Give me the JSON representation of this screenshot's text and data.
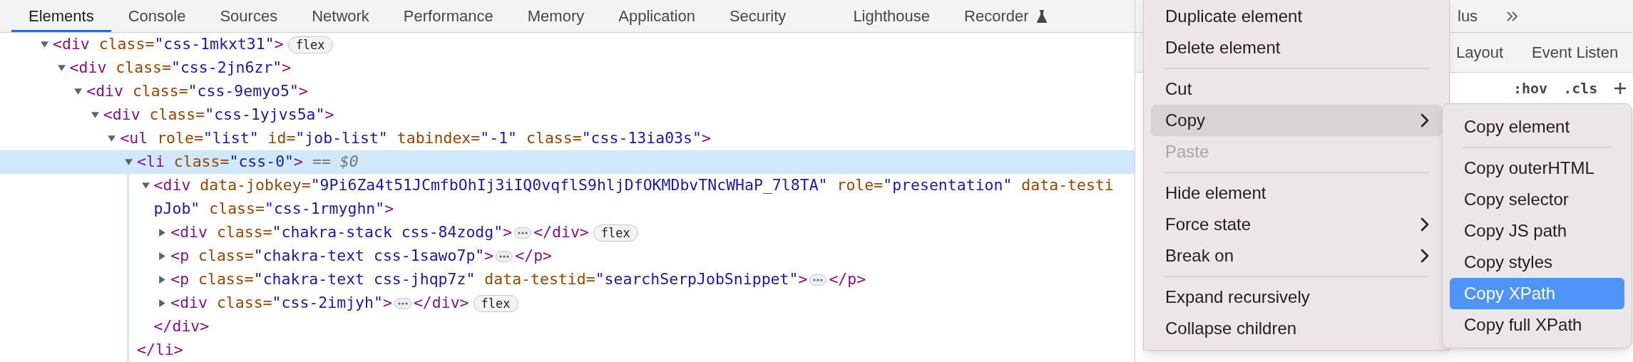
{
  "tabs": [
    {
      "label": "Elements",
      "selected": true,
      "experimental": false
    },
    {
      "label": "Console",
      "selected": false,
      "experimental": false
    },
    {
      "label": "Sources",
      "selected": false,
      "experimental": false
    },
    {
      "label": "Network",
      "selected": false,
      "experimental": false
    },
    {
      "label": "Performance",
      "selected": false,
      "experimental": false
    },
    {
      "label": "Memory",
      "selected": false,
      "experimental": false
    },
    {
      "label": "Application",
      "selected": false,
      "experimental": false
    },
    {
      "label": "Security",
      "selected": false,
      "experimental": false
    },
    {
      "label": "Lighthouse",
      "selected": false,
      "experimental": false
    },
    {
      "label": "Recorder",
      "selected": false,
      "experimental": true
    }
  ],
  "dom_tree": [
    {
      "expanded": true,
      "selected": false,
      "segments": [
        {
          "kind": "code",
          "tokens": [
            {
              "kind": "tag",
              "text": "<div"
            },
            {
              "kind": "attr",
              "text": " class="
            },
            {
              "kind": "value",
              "text": "\"css-1mkxt31\""
            },
            {
              "kind": "tag",
              "text": ">"
            }
          ]
        },
        {
          "kind": "badge",
          "text": "flex"
        }
      ],
      "children": [
        {
          "expanded": true,
          "selected": false,
          "segments": [
            {
              "kind": "code",
              "tokens": [
                {
                  "kind": "tag",
                  "text": "<div"
                },
                {
                  "kind": "attr",
                  "text": " class="
                },
                {
                  "kind": "value",
                  "text": "\"css-2jn6zr\""
                },
                {
                  "kind": "tag",
                  "text": ">"
                }
              ]
            }
          ],
          "children": [
            {
              "expanded": true,
              "selected": false,
              "segments": [
                {
                  "kind": "code",
                  "tokens": [
                    {
                      "kind": "tag",
                      "text": "<div"
                    },
                    {
                      "kind": "attr",
                      "text": " class="
                    },
                    {
                      "kind": "value",
                      "text": "\"css-9emyo5\""
                    },
                    {
                      "kind": "tag",
                      "text": ">"
                    }
                  ]
                }
              ],
              "children": [
                {
                  "expanded": true,
                  "selected": false,
                  "segments": [
                    {
                      "kind": "code",
                      "tokens": [
                        {
                          "kind": "tag",
                          "text": "<div"
                        },
                        {
                          "kind": "attr",
                          "text": " class="
                        },
                        {
                          "kind": "value",
                          "text": "\"css-1yjvs5a\""
                        },
                        {
                          "kind": "tag",
                          "text": ">"
                        }
                      ]
                    }
                  ],
                  "children": [
                    {
                      "expanded": true,
                      "selected": false,
                      "segments": [
                        {
                          "kind": "code",
                          "tokens": [
                            {
                              "kind": "tag",
                              "text": "<ul"
                            },
                            {
                              "kind": "attr",
                              "text": " role="
                            },
                            {
                              "kind": "value",
                              "text": "\"list\""
                            },
                            {
                              "kind": "attr",
                              "text": " id="
                            },
                            {
                              "kind": "value",
                              "text": "\"job-list\""
                            },
                            {
                              "kind": "attr",
                              "text": " tabindex="
                            },
                            {
                              "kind": "value",
                              "text": "\"-1\""
                            },
                            {
                              "kind": "attr",
                              "text": " class="
                            },
                            {
                              "kind": "value",
                              "text": "\"css-13ia03s\""
                            },
                            {
                              "kind": "tag",
                              "text": ">"
                            }
                          ]
                        }
                      ],
                      "children": [
                        {
                          "expanded": true,
                          "selected": true,
                          "segments": [
                            {
                              "kind": "code",
                              "tokens": [
                                {
                                  "kind": "tag",
                                  "text": "<li"
                                },
                                {
                                  "kind": "attr",
                                  "text": " class="
                                },
                                {
                                  "kind": "value",
                                  "text": "\"css-0\""
                                },
                                {
                                  "kind": "tag",
                                  "text": ">"
                                },
                                {
                                  "kind": "note",
                                  "text": " == $0"
                                }
                              ]
                            }
                          ],
                          "closing": "</li>",
                          "children": [
                            {
                              "expanded": true,
                              "selected": false,
                              "segments": [
                                {
                                  "kind": "code",
                                  "tokens": [
                                    {
                                      "kind": "tag",
                                      "text": "<div"
                                    },
                                    {
                                      "kind": "attr",
                                      "text": " data-jobkey="
                                    },
                                    {
                                      "kind": "value",
                                      "text": "\"9Pi6Za4t51JCmfbOhIj3iIQ0vqflS9hljDfOKMDbvTNcWHaP_7l8TA\""
                                    },
                                    {
                                      "kind": "attr",
                                      "text": " role="
                                    },
                                    {
                                      "kind": "value",
                                      "text": "\"presentation\""
                                    },
                                    {
                                      "kind": "attr",
                                      "text": " data-testi"
                                    }
                                  ]
                                }
                              ],
                              "continuation": [
                                {
                                  "kind": "value",
                                  "text": "pJob\""
                                },
                                {
                                  "kind": "attr",
                                  "text": " class="
                                },
                                {
                                  "kind": "value",
                                  "text": "\"css-1rmyghn\""
                                },
                                {
                                  "kind": "tag",
                                  "text": ">"
                                }
                              ],
                              "closing": "</div>",
                              "children": [
                                {
                                  "expanded": false,
                                  "selected": false,
                                  "segments": [
                                    {
                                      "kind": "code",
                                      "tokens": [
                                        {
                                          "kind": "tag",
                                          "text": "<div"
                                        },
                                        {
                                          "kind": "attr",
                                          "text": " class="
                                        },
                                        {
                                          "kind": "value",
                                          "text": "\"chakra-stack css-84zodg\""
                                        },
                                        {
                                          "kind": "tag",
                                          "text": ">"
                                        }
                                      ]
                                    },
                                    {
                                      "kind": "ellipsis"
                                    },
                                    {
                                      "kind": "code",
                                      "tokens": [
                                        {
                                          "kind": "tag",
                                          "text": "</div>"
                                        }
                                      ]
                                    },
                                    {
                                      "kind": "badge",
                                      "text": "flex"
                                    }
                                  ]
                                },
                                {
                                  "expanded": false,
                                  "selected": false,
                                  "segments": [
                                    {
                                      "kind": "code",
                                      "tokens": [
                                        {
                                          "kind": "tag",
                                          "text": "<p"
                                        },
                                        {
                                          "kind": "attr",
                                          "text": " class="
                                        },
                                        {
                                          "kind": "value",
                                          "text": "\"chakra-text css-1sawo7p\""
                                        },
                                        {
                                          "kind": "tag",
                                          "text": ">"
                                        }
                                      ]
                                    },
                                    {
                                      "kind": "ellipsis"
                                    },
                                    {
                                      "kind": "code",
                                      "tokens": [
                                        {
                                          "kind": "tag",
                                          "text": "</p>"
                                        }
                                      ]
                                    }
                                  ]
                                },
                                {
                                  "expanded": false,
                                  "selected": false,
                                  "segments": [
                                    {
                                      "kind": "code",
                                      "tokens": [
                                        {
                                          "kind": "tag",
                                          "text": "<p"
                                        },
                                        {
                                          "kind": "attr",
                                          "text": " class="
                                        },
                                        {
                                          "kind": "value",
                                          "text": "\"chakra-text css-jhqp7z\""
                                        },
                                        {
                                          "kind": "attr",
                                          "text": " data-testid="
                                        },
                                        {
                                          "kind": "value",
                                          "text": "\"searchSerpJobSnippet\""
                                        },
                                        {
                                          "kind": "tag",
                                          "text": ">"
                                        }
                                      ]
                                    },
                                    {
                                      "kind": "ellipsis"
                                    },
                                    {
                                      "kind": "code",
                                      "tokens": [
                                        {
                                          "kind": "tag",
                                          "text": "</p>"
                                        }
                                      ]
                                    }
                                  ]
                                },
                                {
                                  "expanded": false,
                                  "selected": false,
                                  "segments": [
                                    {
                                      "kind": "code",
                                      "tokens": [
                                        {
                                          "kind": "tag",
                                          "text": "<div"
                                        },
                                        {
                                          "kind": "attr",
                                          "text": " class="
                                        },
                                        {
                                          "kind": "value",
                                          "text": "\"css-2imjyh\""
                                        },
                                        {
                                          "kind": "tag",
                                          "text": ">"
                                        }
                                      ]
                                    },
                                    {
                                      "kind": "ellipsis"
                                    },
                                    {
                                      "kind": "code",
                                      "tokens": [
                                        {
                                          "kind": "tag",
                                          "text": "</div>"
                                        }
                                      ]
                                    },
                                    {
                                      "kind": "badge",
                                      "text": "flex"
                                    }
                                  ]
                                }
                              ]
                            }
                          ]
                        }
                      ]
                    }
                  ]
                }
              ]
            }
          ]
        }
      ]
    }
  ],
  "side_panel": {
    "overflow_tab": "lus",
    "tabs": [
      {
        "label": "Layout",
        "selected": false
      },
      {
        "label": "Event Listen",
        "selected": false
      }
    ],
    "filters": [
      ":hov",
      ".cls"
    ]
  },
  "context_menu": [
    {
      "kind": "item",
      "label": "Duplicate element",
      "disabled": false,
      "submenu": false,
      "selected": false
    },
    {
      "kind": "item",
      "label": "Delete element",
      "disabled": false,
      "submenu": false,
      "selected": false
    },
    {
      "kind": "separator"
    },
    {
      "kind": "item",
      "label": "Cut",
      "disabled": false,
      "submenu": false,
      "selected": false
    },
    {
      "kind": "item",
      "label": "Copy",
      "disabled": false,
      "submenu": true,
      "selected": true
    },
    {
      "kind": "item",
      "label": "Paste",
      "disabled": true,
      "submenu": false,
      "selected": false
    },
    {
      "kind": "separator"
    },
    {
      "kind": "item",
      "label": "Hide element",
      "disabled": false,
      "submenu": false,
      "selected": false
    },
    {
      "kind": "item",
      "label": "Force state",
      "disabled": false,
      "submenu": true,
      "selected": false
    },
    {
      "kind": "item",
      "label": "Break on",
      "disabled": false,
      "submenu": true,
      "selected": false
    },
    {
      "kind": "separator"
    },
    {
      "kind": "item",
      "label": "Expand recursively",
      "disabled": false,
      "submenu": false,
      "selected": false
    },
    {
      "kind": "item",
      "label": "Collapse children",
      "disabled": false,
      "submenu": false,
      "selected": false
    }
  ],
  "copy_submenu": [
    {
      "kind": "item",
      "label": "Copy element",
      "selected": false
    },
    {
      "kind": "separator"
    },
    {
      "kind": "item",
      "label": "Copy outerHTML",
      "selected": false
    },
    {
      "kind": "item",
      "label": "Copy selector",
      "selected": false
    },
    {
      "kind": "item",
      "label": "Copy JS path",
      "selected": false
    },
    {
      "kind": "item",
      "label": "Copy styles",
      "selected": false
    },
    {
      "kind": "item",
      "label": "Copy XPath",
      "selected": true
    },
    {
      "kind": "item",
      "label": "Copy full XPath",
      "selected": false
    }
  ]
}
